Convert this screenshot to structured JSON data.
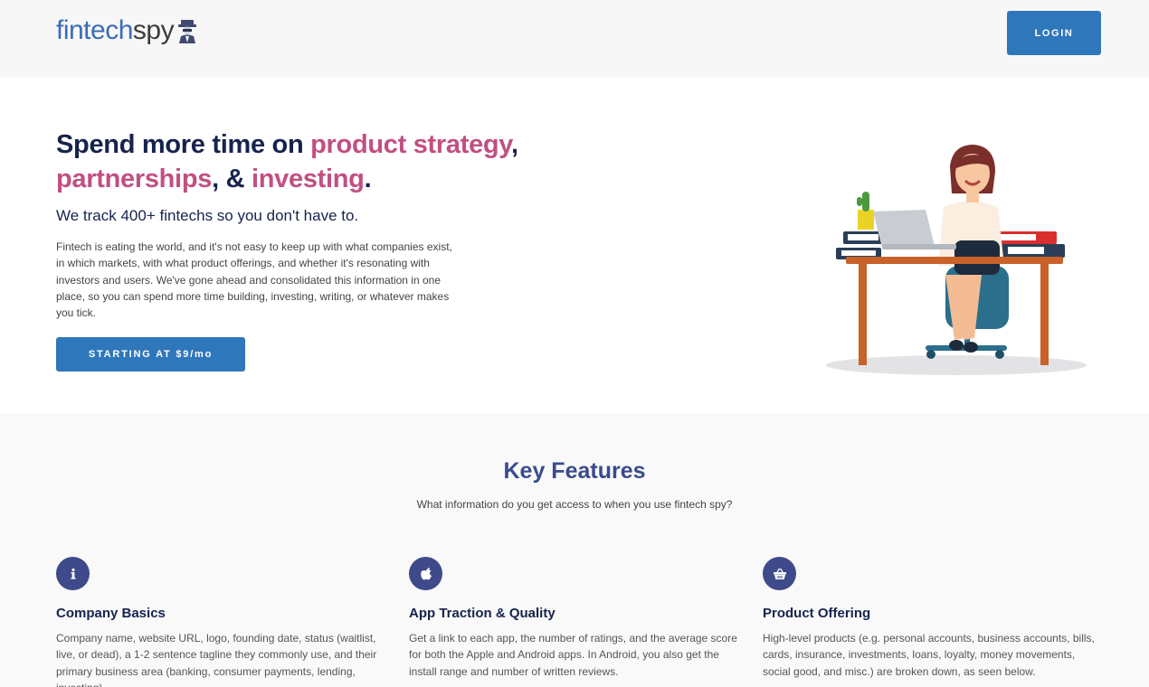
{
  "header": {
    "logo_part1": "fintech",
    "logo_part2": "spy",
    "login_label": "LOGIN"
  },
  "hero": {
    "title_seg1": "Spend more time on ",
    "title_hl1": "product strategy",
    "title_seg2": ",",
    "title_hl2": "partnerships",
    "title_seg3": ", & ",
    "title_hl3": "investing",
    "title_seg4": ".",
    "subtitle": "We track 400+ fintechs so you don't have to.",
    "body": "Fintech is eating the world, and it's not easy to keep up with what companies exist, in which markets, with what product offerings, and whether it's resonating with investors and users. We've gone ahead and consolidated this information in one place, so you can spend more time building, investing, writing, or whatever makes you tick.",
    "cta_label": "STARTING AT $9/mo"
  },
  "features": {
    "title": "Key Features",
    "subtitle": "What information do you get access to when you use fintech spy?",
    "items": [
      {
        "icon": "info-icon",
        "title": "Company Basics",
        "text": "Company name, website URL, logo, founding date, status (waitlist, live, or dead), a 1-2 sentence tagline they commonly use, and their primary business area (banking, consumer payments, lending, investing)."
      },
      {
        "icon": "apple-icon",
        "title": "App Traction & Quality",
        "text": "Get a link to each app, the number of ratings, and the average score for both the Apple and Android apps. In Android, you also get the install range and number of written reviews."
      },
      {
        "icon": "basket-icon",
        "title": "Product Offering",
        "text": "High-level products (e.g. personal accounts, business accounts, bills, cards, insurance, investments, loans, loyalty, money movements, social good, and misc.) are broken down, as seen below."
      }
    ]
  },
  "colors": {
    "accent_blue": "#2f77bb",
    "highlight_pink": "#c24f82",
    "navy": "#16234d",
    "feature_icon_bg": "#3e4a8a"
  }
}
